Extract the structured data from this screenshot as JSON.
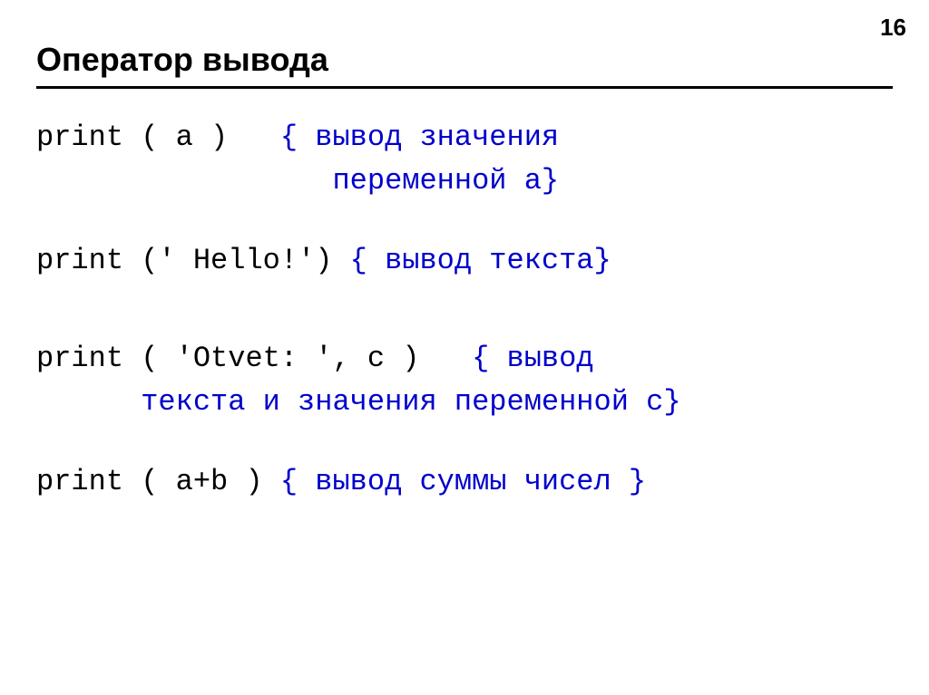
{
  "page_number": "16",
  "title": "Оператор вывода",
  "lines": {
    "l1_code": "print ( a )   ",
    "l1_comment": "{ вывод значения",
    "l1_cont_indent": "                 ",
    "l1_cont_comment": "переменной a}",
    "l2_code": "print (' Hello!') ",
    "l2_comment": "{ вывод текста}",
    "l3_code": "print ( 'Otvet: ', c )   ",
    "l3_comment": "{ вывод",
    "l3_cont_indent": "      ",
    "l3_cont_comment": "текста и значения переменной с}",
    "l4_code": "print ( a+b ) ",
    "l4_comment": "{ вывод суммы чисел }"
  }
}
